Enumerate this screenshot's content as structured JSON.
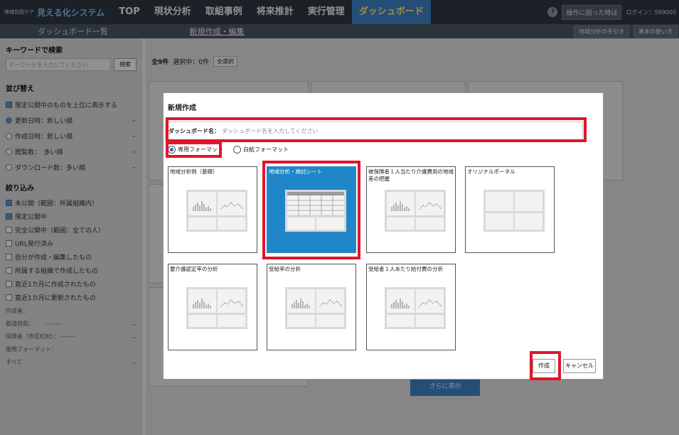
{
  "topnav": {
    "brand_small": "地域包括ケア",
    "brand_big": "見える化システム",
    "items": [
      {
        "label": "TOP"
      },
      {
        "label": "現状分析"
      },
      {
        "label": "取組事例"
      },
      {
        "label": "将来推計"
      },
      {
        "label": "実行管理"
      },
      {
        "label": "ダッシュボード"
      }
    ],
    "help_btn": "操作に困った時は",
    "login": "ログイン：599000"
  },
  "subbar": {
    "left": "ダッシュボード一覧",
    "mid": "新規作成・編集",
    "buttons": [
      "地域分析の手引き",
      "基本の使い方"
    ]
  },
  "sidebar": {
    "keyword_heading": "キーワードで検索",
    "keyword_placeholder": "キーワードを入力してください",
    "search_btn": "検索",
    "sort_heading": "並び替え",
    "sort_limited": "限定公開中のものを上位に表示する",
    "sort_items": [
      {
        "label": "更新日時：新しい順",
        "on": true
      },
      {
        "label": "作成日時：新しい順",
        "on": false
      },
      {
        "label": "閲覧数：　多い順",
        "on": false
      },
      {
        "label": "ダウンロード数：多い順",
        "on": false
      }
    ],
    "filter_heading": "絞り込み",
    "filter_items": [
      {
        "label": "未公開（範囲：所属組織内）",
        "on": true
      },
      {
        "label": "限定公開中",
        "on": true
      },
      {
        "label": "完全公開中（範囲：全ての人）",
        "on": false
      },
      {
        "label": "URL発行済み",
        "on": false
      },
      {
        "label": "自分が作成・編集したもの",
        "on": false
      },
      {
        "label": "所属する組織で作成したもの",
        "on": false
      },
      {
        "label": "直近1カ月に作成されたもの",
        "on": false
      },
      {
        "label": "直近1カ月に更新されたもの",
        "on": false
      }
    ],
    "author_label": "作成者：",
    "pref_label": "都道府県：",
    "pref_value": "--------",
    "insurer_label": "保険者（市区町村）：",
    "insurer_value": "--------",
    "format_label": "使用フォーマット：",
    "format_value": "すべて"
  },
  "main": {
    "count": "全9件",
    "selected": "選択中：0件",
    "select_all": "全選択",
    "more_btn": "さらに表示"
  },
  "modal": {
    "title": "新規作成",
    "name_label": "ダッシュボード名：",
    "name_placeholder": "ダッシュボード名を入力してください",
    "radio_dedicated": "専用フォーマット",
    "radio_blank": "白紙フォーマット",
    "templates": [
      {
        "name": "地域分析例（基礎）",
        "kind": "chart",
        "selected": false
      },
      {
        "name": "地域分析・検討シート",
        "kind": "table",
        "selected": true
      },
      {
        "name": "被保険者１人当たり介護費用の地域差の把握",
        "kind": "chart",
        "selected": false
      },
      {
        "name": "オリジナルポータル",
        "kind": "blank",
        "selected": false
      },
      {
        "name": "要介護認定率の分析",
        "kind": "chart",
        "selected": false
      },
      {
        "name": "受給率の分析",
        "kind": "chart",
        "selected": false
      },
      {
        "name": "受給者１人あたり給付費の分析",
        "kind": "chart",
        "selected": false
      }
    ],
    "create_btn": "作成",
    "cancel_btn": "キャンセル"
  }
}
